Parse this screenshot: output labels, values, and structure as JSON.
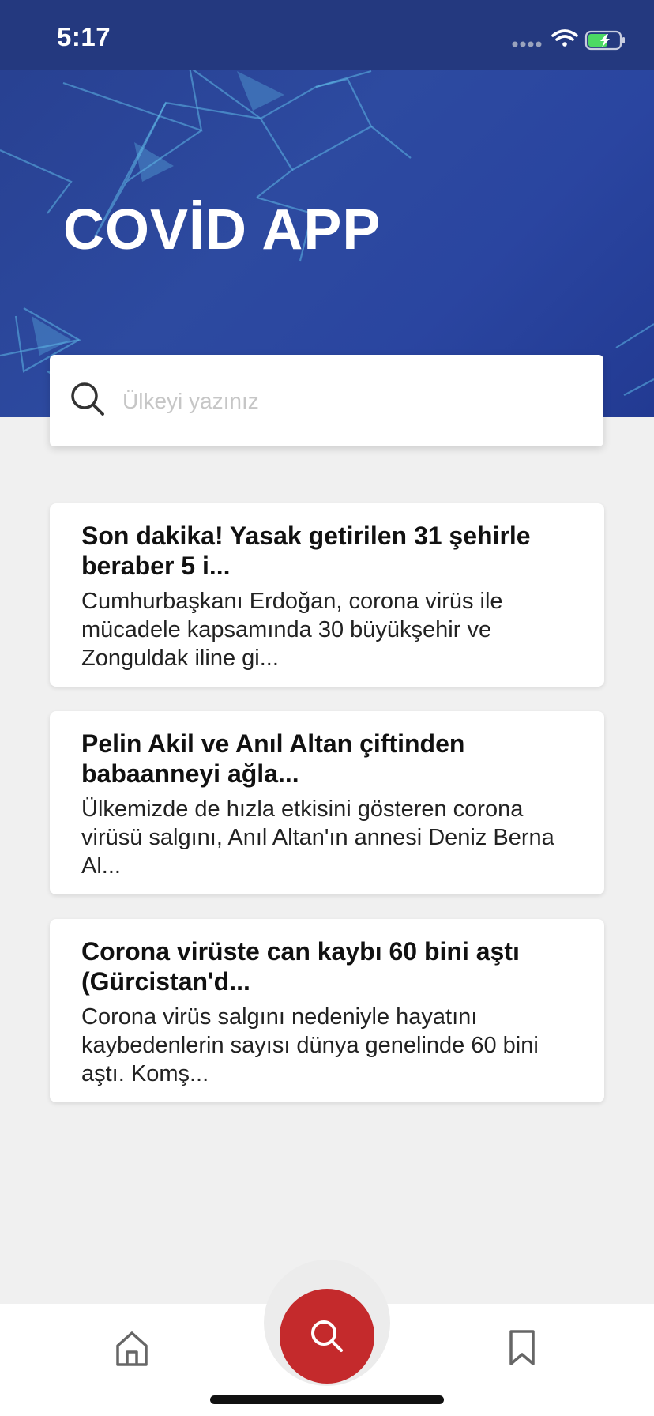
{
  "status_bar": {
    "time": "5:17"
  },
  "header": {
    "title": "COVİD APP"
  },
  "search": {
    "placeholder": "Ülkeyi yazınız",
    "value": ""
  },
  "news": [
    {
      "title": "Son dakika! Yasak getirilen 31 şehirle beraber 5 i...",
      "summary": "Cumhurbaşkanı Erdoğan, corona virüs ile mücadele kapsamında 30 büyükşehir ve Zonguldak iline gi..."
    },
    {
      "title": "Pelin Akil ve Anıl Altan çiftinden babaanneyi ağla...",
      "summary": "Ülkemizde de hızla etkisini gösteren corona virüsü salgını, Anıl Altan'ın annesi Deniz Berna Al..."
    },
    {
      "title": "Corona virüste can kaybı 60 bini aştı (Gürcistan'd...",
      "summary": "Corona virüs salgını nedeniyle hayatını kaybedenlerin sayısı dünya genelinde 60 bini aştı. Komş..."
    }
  ],
  "tabbar": {
    "items": [
      {
        "icon": "home-icon"
      },
      {
        "icon": "search-icon",
        "active": true
      },
      {
        "icon": "bookmark-icon"
      }
    ]
  },
  "colors": {
    "header_blue": "#2a45a0",
    "status_bar": "#24397f",
    "accent_red": "#c42a2c",
    "background": "#f0f0f0",
    "battery_green": "#4cd964"
  }
}
